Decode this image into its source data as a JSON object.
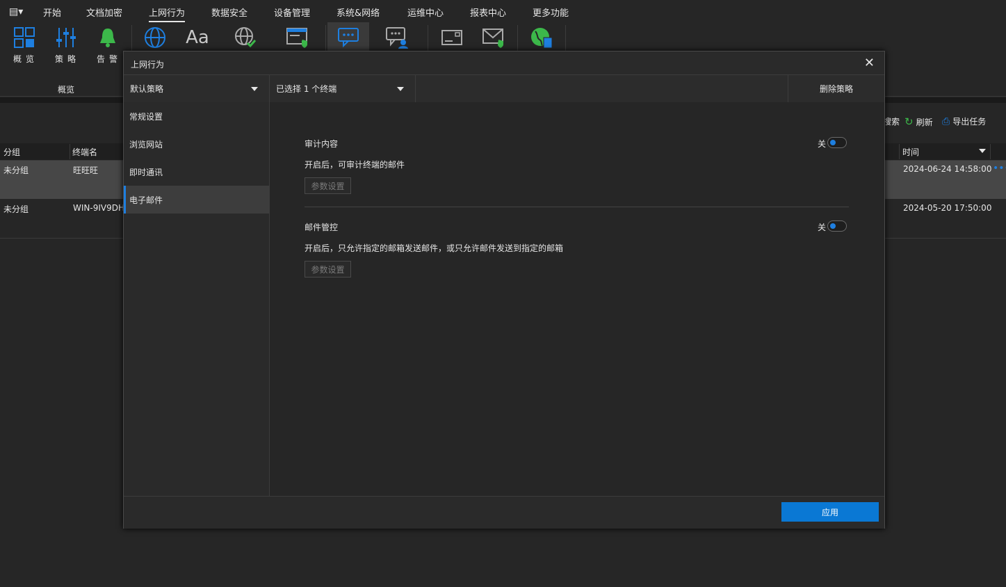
{
  "menubar": {
    "items": [
      "开始",
      "文档加密",
      "上网行为",
      "数据安全",
      "设备管理",
      "系统&网络",
      "运维中心",
      "报表中心",
      "更多功能"
    ],
    "active": "上网行为"
  },
  "ribbon": {
    "overview_label": "概览",
    "policy_label": "策略",
    "alarm_label": "告警",
    "group_label": "概览"
  },
  "toolbar_right": {
    "search": "搜索",
    "refresh": "刷新",
    "export": "导出任务"
  },
  "table": {
    "headers": {
      "group": "分组",
      "terminal": "终端名",
      "time": "时间"
    },
    "rows": [
      {
        "group": "未分组",
        "terminal": "旺旺旺",
        "time": "2024-06-24 14:58:00"
      },
      {
        "group": "未分组",
        "terminal": "WIN-9IV9DH",
        "time": "2024-05-20 17:50:00"
      }
    ]
  },
  "dialog": {
    "title": "上网行为",
    "policy_select": "默认策略",
    "terminal_select": "已选择 1 个终端",
    "delete_policy": "删除策略",
    "nav": [
      "常规设置",
      "浏览网站",
      "即时通讯",
      "电子邮件"
    ],
    "active_nav": "电子邮件",
    "sections": [
      {
        "title": "审计内容",
        "desc": "开启后，可审计终端的邮件",
        "button": "参数设置",
        "toggle_label": "关",
        "enabled": false
      },
      {
        "title": "邮件管控",
        "desc": "开启后，只允许指定的邮箱发送邮件，或只允许邮件发送到指定的邮箱",
        "button": "参数设置",
        "toggle_label": "关",
        "enabled": false
      }
    ],
    "apply": "应用"
  },
  "colors": {
    "accent": "#0a78d4",
    "icon_blue": "#1e7fe0",
    "icon_green": "#3cb84a"
  }
}
